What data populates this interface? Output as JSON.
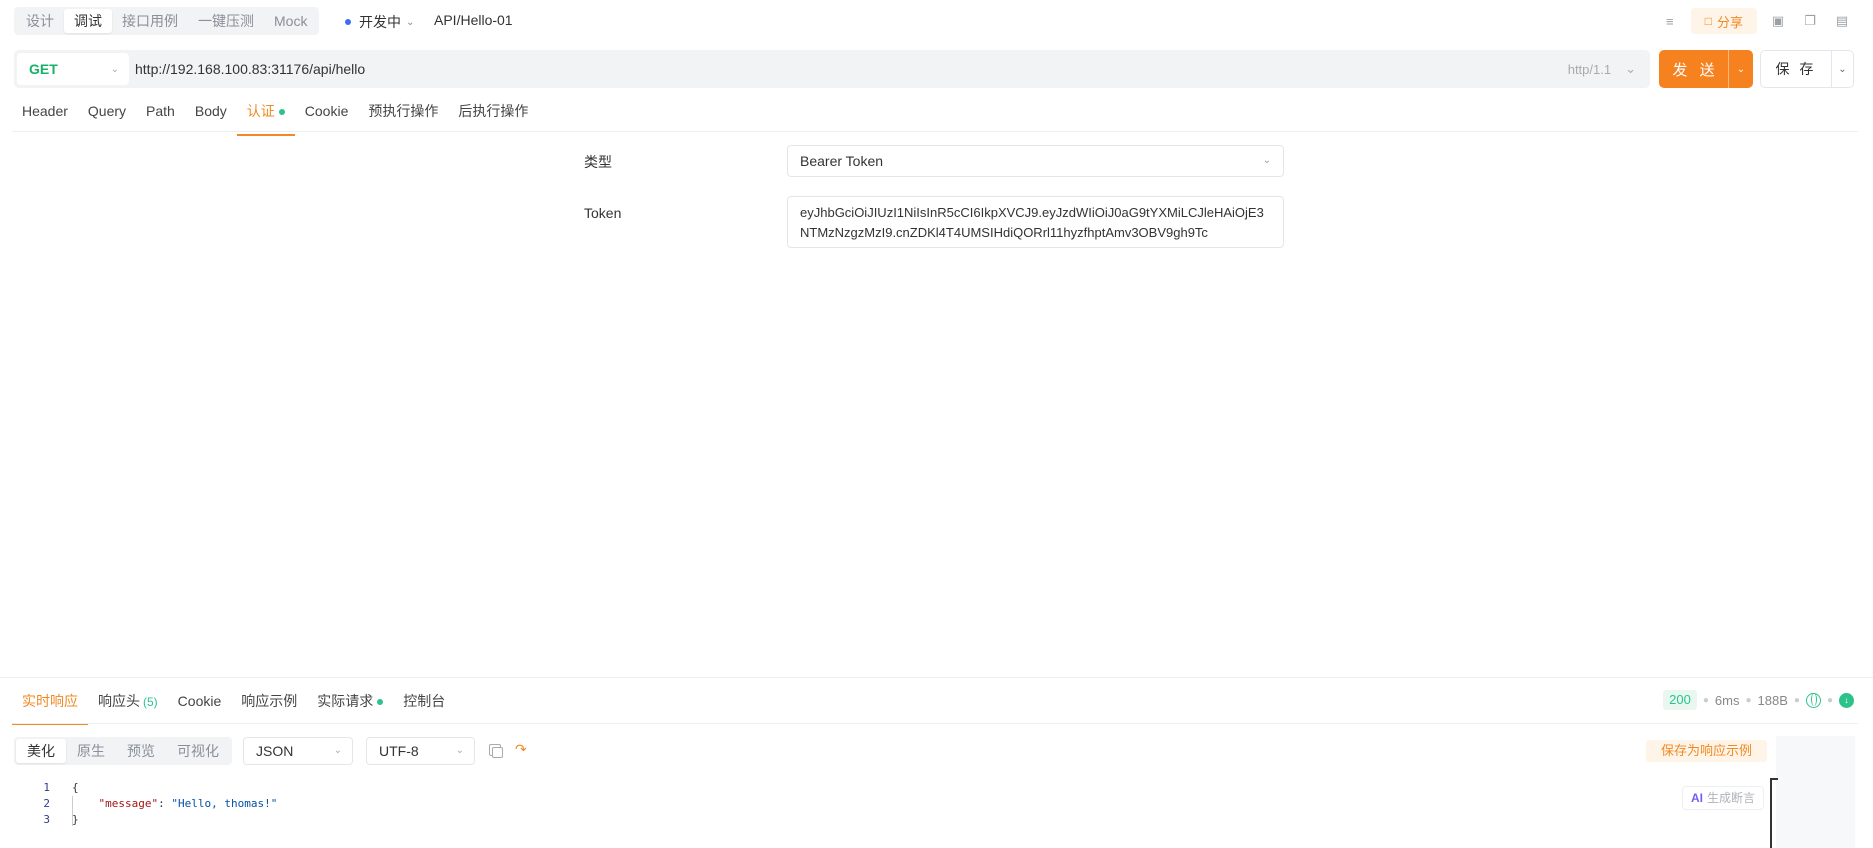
{
  "mode_tabs": [
    "设计",
    "调试",
    "接口用例",
    "一键压测",
    "Mock"
  ],
  "env": {
    "label": "开发中"
  },
  "breadcrumb": "API/Hello-01",
  "top_actions": {
    "share_label": "分享"
  },
  "request": {
    "method": "GET",
    "url": "http://192.168.100.83:31176/api/hello",
    "protocol": "http/1.1",
    "send_label": "发 送",
    "save_label": "保 存"
  },
  "request_tabs": [
    "Header",
    "Query",
    "Path",
    "Body",
    "认证",
    "Cookie",
    "预执行操作",
    "后执行操作"
  ],
  "auth": {
    "type_label": "类型",
    "type_value": "Bearer Token",
    "token_label": "Token",
    "token_value": "eyJhbGciOiJIUzI1NiIsInR5cCI6IkpXVCJ9.eyJzdWIiOiJ0aG9tYXMiLCJleHAiOjE3NTMzNzgzMzI9.cnZDKl4T4UMSIHdiQORrl11hyzfhptAmv3OBV9gh9Tc"
  },
  "response_tabs": {
    "realtime": "实时响应",
    "headers": "响应头",
    "headers_count": "(5)",
    "cookie": "Cookie",
    "example": "响应示例",
    "actual_request": "实际请求",
    "console": "控制台"
  },
  "response_stats": {
    "status": "200",
    "time": "6ms",
    "size": "188B"
  },
  "view_tabs": [
    "美化",
    "原生",
    "预览",
    "可视化"
  ],
  "format_select": "JSON",
  "encoding_select": "UTF-8",
  "save_example_label": "保存为响应示例",
  "ai_button": {
    "badge": "AI",
    "label": "生成断言"
  },
  "code": {
    "line_numbers": [
      "1",
      "2",
      "3"
    ],
    "open_brace": "{",
    "key": "\"message\"",
    "colon": ": ",
    "value": "\"Hello, thomas!\"",
    "close_brace": "}"
  }
}
